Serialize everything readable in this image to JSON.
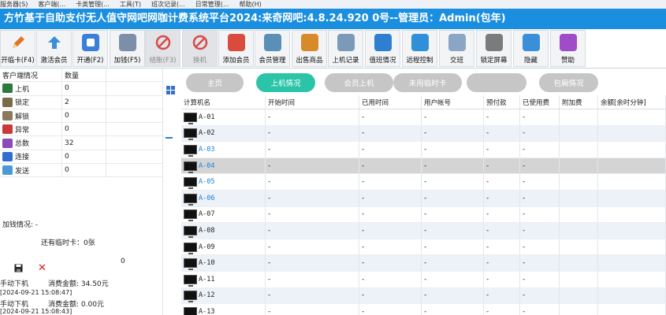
{
  "menu": [
    "服务器(S)",
    "客户端(...",
    "卡类管理(...",
    "工具(T)",
    "班次记录(...",
    "日常管理(...",
    "帮助(H)"
  ],
  "title": "方竹基于自助支付无人值守网吧网咖计费系统平台2024:来奇网吧:4.8.24.920 0号--管理员：Admin(包年)",
  "toolbar": [
    {
      "label": "开临卡(F4)",
      "icon": "pencil-icon",
      "color": "#e0752b",
      "disabled": false
    },
    {
      "label": "激活会员",
      "icon": "up-arrow-icon",
      "color": "#3a8fd8",
      "disabled": false
    },
    {
      "label": "开通(F2)",
      "icon": "stop-icon",
      "color": "#3a7fd8",
      "disabled": false
    },
    {
      "label": "加钱(F5)",
      "icon": "calculator-icon",
      "color": "#7d8ea8",
      "disabled": false
    },
    {
      "label": "结账(F3)",
      "icon": "no-entry-icon",
      "color": "#d84a4a",
      "disabled": true
    },
    {
      "label": "换机",
      "icon": "no-entry-icon",
      "color": "#d84a4a",
      "disabled": true
    },
    {
      "label": "添加会员",
      "icon": "add-user-icon",
      "color": "#d94b3c",
      "disabled": false
    },
    {
      "label": "会员管理",
      "icon": "card-icon",
      "color": "#5a8fb8",
      "disabled": false
    },
    {
      "label": "出售商品",
      "icon": "bottle-icon",
      "color": "#d88a2a",
      "disabled": false
    },
    {
      "label": "上机记录",
      "icon": "pen-icon",
      "color": "#7a9ab8",
      "disabled": false
    },
    {
      "label": "值班情况",
      "icon": "user-icon",
      "color": "#2f7fd0",
      "disabled": false
    },
    {
      "label": "远程控制",
      "icon": "monitor-icon",
      "color": "#2f8fd8",
      "disabled": false
    },
    {
      "label": "交班",
      "icon": "document-icon",
      "color": "#8aa6c4",
      "disabled": false
    },
    {
      "label": "锁定屏幕",
      "icon": "lock-icon",
      "color": "#7b7b7b",
      "disabled": false
    },
    {
      "label": "隐藏",
      "icon": "book-icon",
      "color": "#3a8fd8",
      "disabled": false
    },
    {
      "label": "赞助",
      "icon": "money-bag-icon",
      "color": "#a04bc8",
      "disabled": false
    }
  ],
  "status_table": {
    "headers": [
      "客户端情况",
      "数量"
    ],
    "rows": [
      {
        "label": "上机",
        "count": "0",
        "icon": "online-icon",
        "color": "#2c7a3c"
      },
      {
        "label": "锁定",
        "count": "2",
        "icon": "lock-icon",
        "color": "#7a6a4a"
      },
      {
        "label": "解锁",
        "count": "0",
        "icon": "unlock-icon",
        "color": "#8a7a5a"
      },
      {
        "label": "异常",
        "count": "0",
        "icon": "error-icon",
        "color": "#c83a3a"
      },
      {
        "label": "总数",
        "count": "32",
        "icon": "monitor-icon",
        "color": "#8a4ab8"
      },
      {
        "label": "连接",
        "count": "0",
        "icon": "connect-icon",
        "color": "#2f6fd0"
      },
      {
        "label": "发送",
        "count": "0",
        "icon": "send-icon",
        "color": "#4a9ad8"
      }
    ]
  },
  "left_info": {
    "recharge_label": "加钱情况: -",
    "temp_cards": "还有临时卡：0张",
    "zero_value": "0",
    "log": [
      {
        "action": "手动下机",
        "amount": "消费金额: 34.50元",
        "time": "[2024-09-21 15:08:47]"
      },
      {
        "action": "手动下机",
        "amount": "消费金额: 0.00元",
        "time": "[2024-09-21 15:08:43]"
      }
    ]
  },
  "tabs": [
    {
      "label": "主页",
      "active": false
    },
    {
      "label": "上机情况",
      "active": true
    },
    {
      "label": "会员上机",
      "active": false
    },
    {
      "label": "未用临时卡",
      "active": false
    },
    {
      "label": "",
      "active": false
    },
    {
      "label": "包厢情况",
      "active": false
    }
  ],
  "grid": {
    "columns": [
      "计算机名",
      "开始时间",
      "已用时间",
      "用户帐号",
      "预付款",
      "已使用费",
      "附加费",
      "余额[余时分钟]"
    ],
    "rows": [
      {
        "name": "A-01",
        "blue": false,
        "cells": [
          "-",
          "-",
          "-",
          "-",
          "-",
          "",
          ""
        ]
      },
      {
        "name": "A-02",
        "blue": false,
        "cells": [
          "-",
          "-",
          "-",
          "-",
          "-",
          "",
          ""
        ]
      },
      {
        "name": "A-03",
        "blue": true,
        "cells": [
          "-",
          "-",
          "-",
          "-",
          "-",
          "",
          ""
        ]
      },
      {
        "name": "A-04",
        "blue": true,
        "cells": [
          "-",
          "-",
          "-",
          "-",
          "-",
          "",
          ""
        ]
      },
      {
        "name": "A-05",
        "blue": true,
        "cells": [
          "-",
          "-",
          "-",
          "-",
          "-",
          "",
          ""
        ]
      },
      {
        "name": "A-06",
        "blue": true,
        "cells": [
          "-",
          "-",
          "-",
          "-",
          "-",
          "",
          ""
        ]
      },
      {
        "name": "A-07",
        "blue": false,
        "cells": [
          "-",
          "-",
          "-",
          "-",
          "-",
          "",
          ""
        ]
      },
      {
        "name": "A-08",
        "blue": false,
        "cells": [
          "-",
          "-",
          "-",
          "-",
          "-",
          "",
          ""
        ]
      },
      {
        "name": "A-09",
        "blue": false,
        "cells": [
          "-",
          "-",
          "-",
          "-",
          "-",
          "",
          ""
        ]
      },
      {
        "name": "A-10",
        "blue": false,
        "cells": [
          "-",
          "-",
          "-",
          "-",
          "-",
          "",
          ""
        ]
      },
      {
        "name": "A-11",
        "blue": false,
        "cells": [
          "-",
          "-",
          "-",
          "-",
          "-",
          "",
          ""
        ]
      },
      {
        "name": "A-12",
        "blue": false,
        "cells": [
          "-",
          "-",
          "-",
          "-",
          "-",
          "",
          ""
        ]
      },
      {
        "name": "A-13",
        "blue": false,
        "cells": [
          "-",
          "-",
          "-",
          "-",
          "-",
          "",
          ""
        ]
      }
    ],
    "selected_row": "A-04"
  },
  "colors": {
    "title_bar": "#1a8fe0",
    "active_tab": "#2cc4a9",
    "inactive_tab": "#c6c6c6",
    "link_blue": "#1a7fd6"
  }
}
